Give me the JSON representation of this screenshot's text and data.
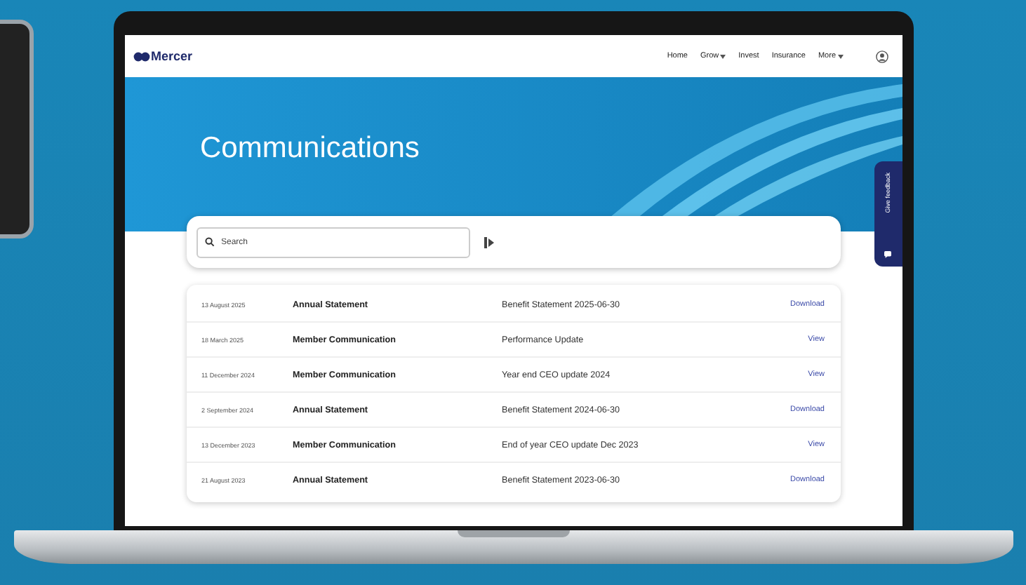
{
  "nav": {
    "logo": "Mercer",
    "items": [
      {
        "label": "Home",
        "dropdown": false
      },
      {
        "label": "Grow",
        "dropdown": true
      },
      {
        "label": "Invest",
        "dropdown": false
      },
      {
        "label": "Insurance",
        "dropdown": false
      },
      {
        "label": "More",
        "dropdown": true
      }
    ]
  },
  "page_title": "Communications",
  "search": {
    "placeholder": "Search"
  },
  "feedback_tab": {
    "label": "Give feedback"
  },
  "rows": [
    {
      "date": "13 August 2025",
      "type": "Annual Statement",
      "description": "Benefit Statement 2025-06-30",
      "action": "Download"
    },
    {
      "date": "18 March 2025",
      "type": "Member Communication",
      "description": "Performance Update",
      "action": "View"
    },
    {
      "date": "11 December 2024",
      "type": "Member Communication",
      "description": "Year end CEO update 2024",
      "action": "View"
    },
    {
      "date": "2 September 2024",
      "type": "Annual Statement",
      "description": "Benefit Statement 2024-06-30",
      "action": "Download"
    },
    {
      "date": "13 December 2023",
      "type": "Member Communication",
      "description": "End of year CEO update Dec 2023",
      "action": "View"
    },
    {
      "date": "21 August 2023",
      "type": "Annual Statement",
      "description": "Benefit Statement 2023-06-30",
      "action": "Download"
    }
  ]
}
